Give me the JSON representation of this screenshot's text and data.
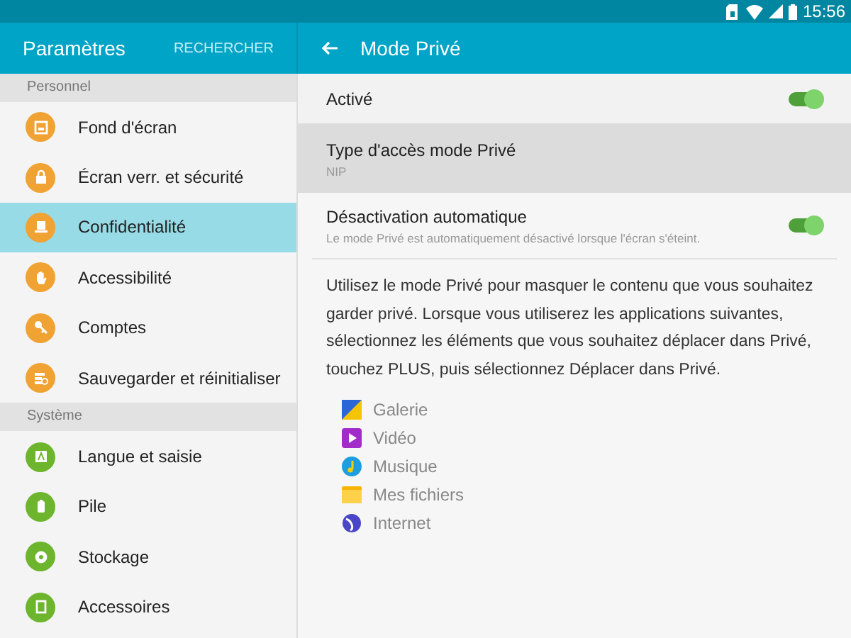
{
  "status_bar": {
    "time": "15:56"
  },
  "sidebar": {
    "title": "Paramètres",
    "search_button": "RECHERCHER",
    "sections": [
      {
        "title": "Personnel",
        "items": [
          {
            "label": "Fond d'écran",
            "color": "#f0a232",
            "selected": false
          },
          {
            "label": "Écran verr. et sécurité",
            "color": "#f0a232",
            "selected": false
          },
          {
            "label": "Confidentialité",
            "color": "#f0a232",
            "selected": true
          },
          {
            "label": "Accessibilité",
            "color": "#f0a232",
            "selected": false
          },
          {
            "label": "Comptes",
            "color": "#f0a232",
            "selected": false
          },
          {
            "label": "Sauvegarder et réinitialiser",
            "color": "#f0a232",
            "selected": false
          }
        ]
      },
      {
        "title": "Système",
        "items": [
          {
            "label": "Langue et saisie",
            "color": "#6cb52d",
            "selected": false
          },
          {
            "label": "Pile",
            "color": "#6cb52d",
            "selected": false
          },
          {
            "label": "Stockage",
            "color": "#6cb52d",
            "selected": false
          },
          {
            "label": "Accessoires",
            "color": "#6cb52d",
            "selected": false
          }
        ]
      }
    ]
  },
  "detail": {
    "title": "Mode Privé",
    "settings": [
      {
        "kind": "switch",
        "label": "Activé",
        "on": true
      },
      {
        "kind": "choice",
        "label": "Type d'accès mode Privé",
        "value": "NIP"
      },
      {
        "kind": "switch",
        "label": "Désactivation automatique",
        "summary": "Le mode Privé est automatiquement désactivé lorsque l'écran s'éteint.",
        "on": true
      }
    ],
    "description": "Utilisez le mode Privé pour masquer le contenu que vous souhaitez garder privé. Lorsque vous utiliserez les applications suivantes, sélectionnez les éléments que vous souhaitez déplacer dans Privé, touchez PLUS, puis sélectionnez Déplacer dans Privé.",
    "apps": [
      "Galerie",
      "Vidéo",
      "Musique",
      "Mes fichiers",
      "Internet"
    ]
  }
}
